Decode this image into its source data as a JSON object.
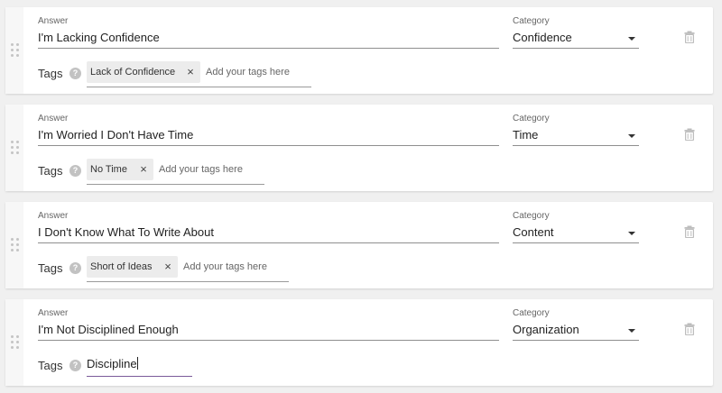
{
  "labels": {
    "answer": "Answer",
    "category": "Category",
    "tags": "Tags",
    "help": "?",
    "remove": "×"
  },
  "tags_placeholder": "Add your tags here",
  "items": [
    {
      "answer": "I'm Lacking Confidence",
      "category": "Confidence",
      "tags": [
        "Lack of Confidence"
      ]
    },
    {
      "answer": "I'm Worried I Don't Have Time",
      "category": "Time",
      "tags": [
        "No Time"
      ]
    },
    {
      "answer": "I Don't Know What To Write About",
      "category": "Content",
      "tags": [
        "Short of Ideas"
      ]
    },
    {
      "answer": "I'm Not Disciplined Enough",
      "category": "Organization",
      "tags": [],
      "tag_input_value": "Discipline"
    }
  ],
  "icons": {
    "drag": "drag-handle-icon",
    "trash": "trash-icon",
    "caret": "caret-down-icon",
    "help": "help-icon",
    "close": "close-icon"
  },
  "colors": {
    "background": "#f0f0f0",
    "card": "#ffffff",
    "chip": "#ececec",
    "focus_underline": "#7a5a9a"
  }
}
